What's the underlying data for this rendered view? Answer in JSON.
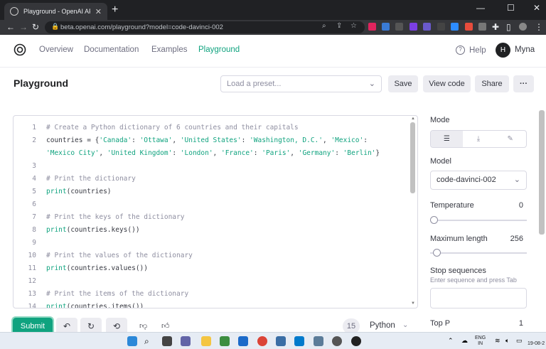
{
  "browser": {
    "tab_title": "Playground - OpenAI API",
    "tab_close": "✕",
    "new_tab": "+",
    "url": "beta.openai.com/playground?model=code-davinci-002",
    "window_controls": [
      "—",
      "☐",
      "✕"
    ]
  },
  "nav": {
    "links": [
      "Overview",
      "Documentation",
      "Examples",
      "Playground"
    ],
    "active": "Playground",
    "help": "Help",
    "avatar_initial": "H",
    "username": "Myna"
  },
  "page": {
    "title": "Playground",
    "preset_placeholder": "Load a preset...",
    "buttons": {
      "save": "Save",
      "view_code": "View code",
      "share": "Share",
      "more": "···"
    }
  },
  "editor": {
    "lines": [
      {
        "n": "1",
        "code": "# Create a Python dictionary of 6 countries and their capitals",
        "kind": "comment"
      },
      {
        "n": "2",
        "code": "countries = {'Canada': 'Ottawa', 'United States': 'Washington, D.C.', 'Mexico':",
        "kind": "code"
      },
      {
        "n": "",
        "code": "'Mexico City', 'United Kingdom': 'London', 'France': 'Paris', 'Germany': 'Berlin'}",
        "kind": "code"
      },
      {
        "n": "3",
        "code": "",
        "kind": "code"
      },
      {
        "n": "4",
        "code": "# Print the dictionary",
        "kind": "comment"
      },
      {
        "n": "5",
        "code": "print(countries)",
        "kind": "code"
      },
      {
        "n": "6",
        "code": "",
        "kind": "code"
      },
      {
        "n": "7",
        "code": "# Print the keys of the dictionary",
        "kind": "comment"
      },
      {
        "n": "8",
        "code": "print(countries.keys())",
        "kind": "code"
      },
      {
        "n": "9",
        "code": "",
        "kind": "code"
      },
      {
        "n": "10",
        "code": "# Print the values of the dictionary",
        "kind": "comment"
      },
      {
        "n": "11",
        "code": "print(countries.values())",
        "kind": "code"
      },
      {
        "n": "12",
        "code": "",
        "kind": "code"
      },
      {
        "n": "13",
        "code": "# Print the items of the dictionary",
        "kind": "comment"
      },
      {
        "n": "14",
        "code": "print(countries.items())",
        "kind": "code"
      }
    ],
    "submit": "Submit",
    "token_count": "15",
    "language": "Python"
  },
  "settings": {
    "mode_label": "Mode",
    "model_label": "Model",
    "model_value": "code-davinci-002",
    "temperature_label": "Temperature",
    "temperature_value": "0",
    "temperature_level": 0,
    "max_length_label": "Maximum length",
    "max_length_value": "256",
    "max_length_level": 0.03,
    "stop_label": "Stop sequences",
    "stop_hint": "Enter sequence and press Tab",
    "top_p_label": "Top P",
    "top_p_value": "1"
  },
  "taskbar": {
    "lang": "ENG",
    "region": "IN",
    "date": "19-08-2"
  }
}
